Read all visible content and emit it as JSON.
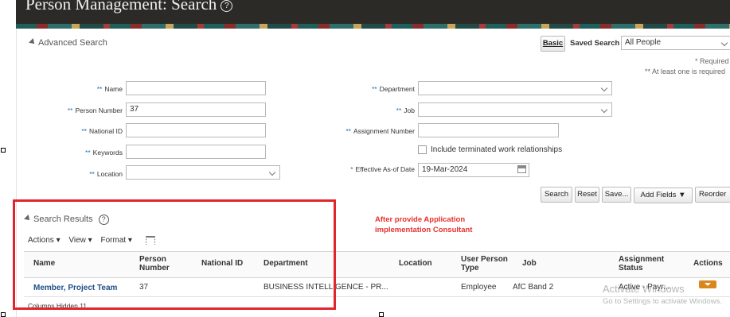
{
  "header": {
    "title": "Person Management: Search",
    "help_glyph": "?"
  },
  "advanced_search": {
    "title": "Advanced Search",
    "basic_button": "Basic",
    "saved_search_label": "Saved Search",
    "saved_search_value": "All People",
    "required_note": "* Required",
    "at_least_one_note": "** At least one is required"
  },
  "form": {
    "name_label": "Name",
    "name_value": "",
    "person_number_label": "Person Number",
    "person_number_value": "37",
    "national_id_label": "National ID",
    "national_id_value": "",
    "keywords_label": "Keywords",
    "keywords_value": "",
    "location_label": "Location",
    "location_value": "",
    "department_label": "Department",
    "department_value": "",
    "job_label": "Job",
    "job_value": "",
    "assignment_number_label": "Assignment Number",
    "assignment_number_value": "",
    "include_terminated_label": "Include terminated work relationships",
    "effective_date_label": "Effective As-of Date",
    "effective_date_value": "19-Mar-2024",
    "req_double": "**",
    "req_single": "*"
  },
  "buttons": {
    "search": "Search",
    "reset": "Reset",
    "save": "Save...",
    "add_fields": "Add Fields",
    "reorder": "Reorder"
  },
  "results": {
    "title": "Search Results",
    "help_glyph": "?",
    "annotation_line1": "After provide Application",
    "annotation_line2": "implementation Consultant",
    "annotation_color": "#e8302e",
    "toolbar": {
      "actions": "Actions",
      "view": "View",
      "format": "Format"
    },
    "columns": {
      "name": "Name",
      "person_number_1": "Person",
      "person_number_2": "Number",
      "national_id": "National ID",
      "department": "Department",
      "location": "Location",
      "user_person_type_1": "User Person",
      "user_person_type_2": "Type",
      "job": "Job",
      "assignment_status_1": "Assignment",
      "assignment_status_2": "Status",
      "actions": "Actions"
    },
    "row": {
      "name": "Member, Project Team",
      "person_number": "37",
      "national_id": "",
      "department": "BUSINESS INTELLIGENCE - PR...",
      "location": "",
      "user_person_type": "Employee",
      "job": "AfC Band 2",
      "assignment_status": "Active - Payr..."
    },
    "columns_hidden": "Columns Hidden  11"
  },
  "watermark": {
    "line1": "Activate Windows",
    "line2": "Go to Settings to activate Windows."
  },
  "colors": {
    "link": "#1f4f8b",
    "accent_orange": "#d9861a",
    "highlight_box": "#e0262c"
  },
  "icons": {
    "calendar": "calendar-icon",
    "freeze": "freeze-columns-icon",
    "collapse": "collapse-triangle-icon",
    "actions_menu": "actions-menu-icon"
  }
}
